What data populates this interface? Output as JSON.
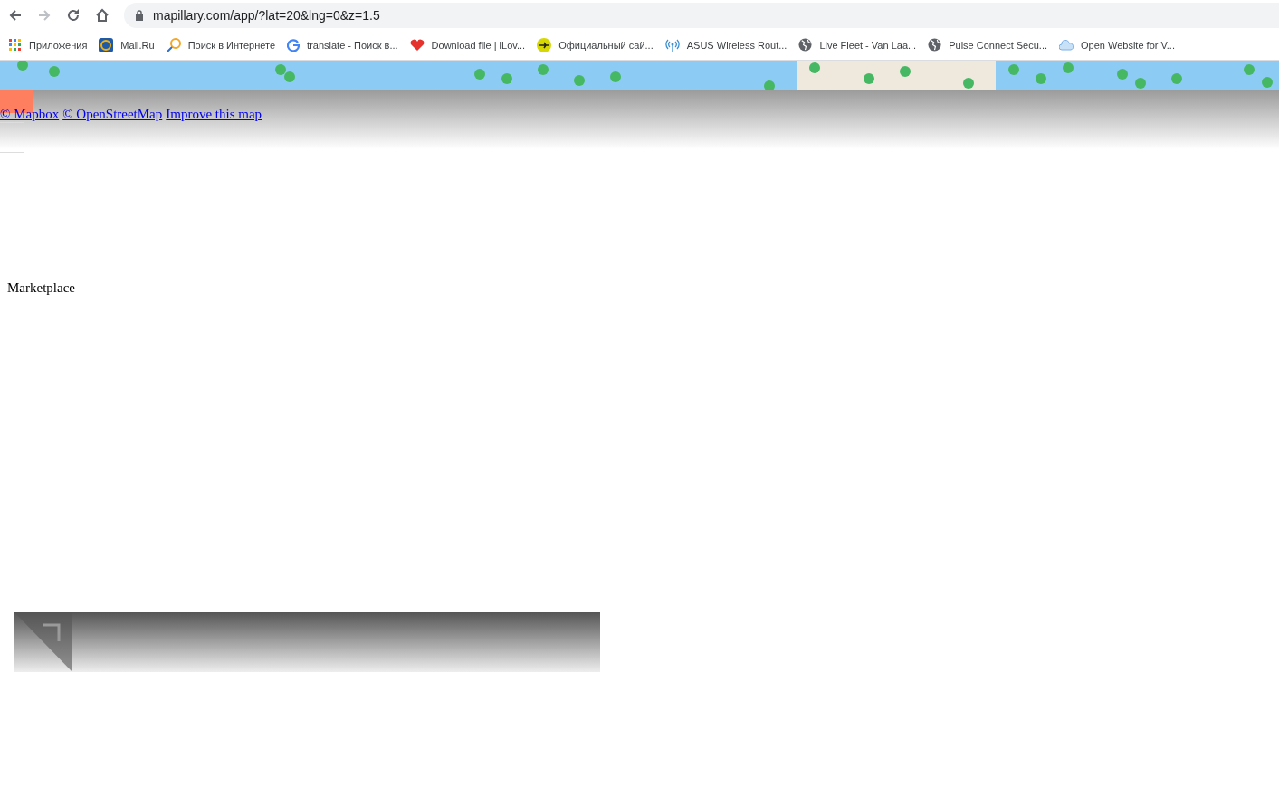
{
  "browser": {
    "address": "mapillary.com/app/?lat=20&lng=0&z=1.5",
    "bookmarks": [
      {
        "label": "Приложения",
        "kind": "apps"
      },
      {
        "label": "Mail.Ru",
        "kind": "mail"
      },
      {
        "label": "Поиск в Интернете",
        "kind": "search"
      },
      {
        "label": "translate - Поиск в...",
        "kind": "google"
      },
      {
        "label": "Download file | iLov...",
        "kind": "heart"
      },
      {
        "label": "Официальный сай...",
        "kind": "plane"
      },
      {
        "label": "ASUS Wireless Rout...",
        "kind": "wireless"
      },
      {
        "label": "Live Fleet - Van Laa...",
        "kind": "globe"
      },
      {
        "label": "Pulse Connect Secu...",
        "kind": "globe"
      },
      {
        "label": "Open Website for V...",
        "kind": "cloud"
      }
    ]
  },
  "map": {
    "attribution": [
      "© Mapbox",
      "© OpenStreetMap",
      "Improve this map"
    ]
  },
  "page": {
    "marketplace": "Marketplace"
  }
}
